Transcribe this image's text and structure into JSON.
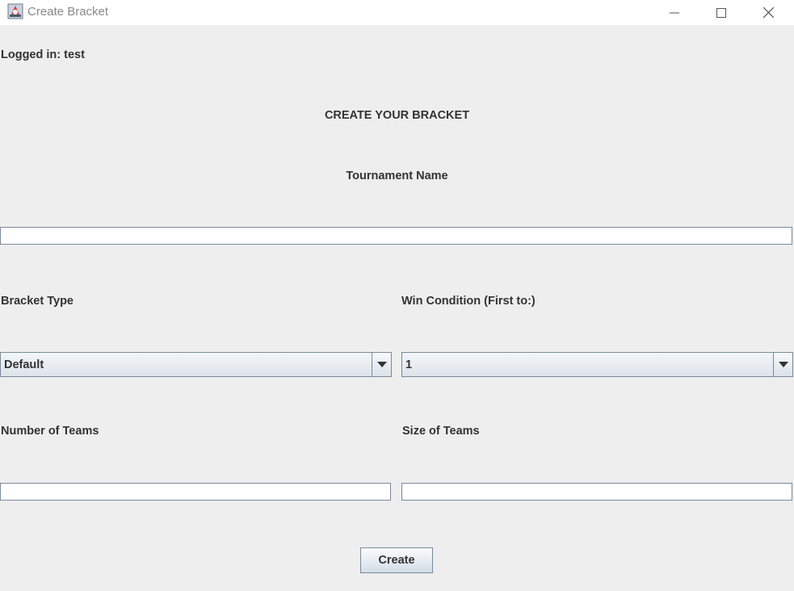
{
  "window": {
    "title": "Create Bracket"
  },
  "user": {
    "logged_in_label": "Logged in: test"
  },
  "form": {
    "heading": "CREATE YOUR BRACKET",
    "tournament_name_label": "Tournament Name",
    "tournament_name_value": "",
    "bracket_type_label": "Bracket Type",
    "bracket_type_value": "Default",
    "win_condition_label": "Win Condition (First to:)",
    "win_condition_value": "1",
    "number_of_teams_label": "Number of Teams",
    "number_of_teams_value": "",
    "size_of_teams_label": "Size of Teams",
    "size_of_teams_value": "",
    "create_label": "Create"
  }
}
